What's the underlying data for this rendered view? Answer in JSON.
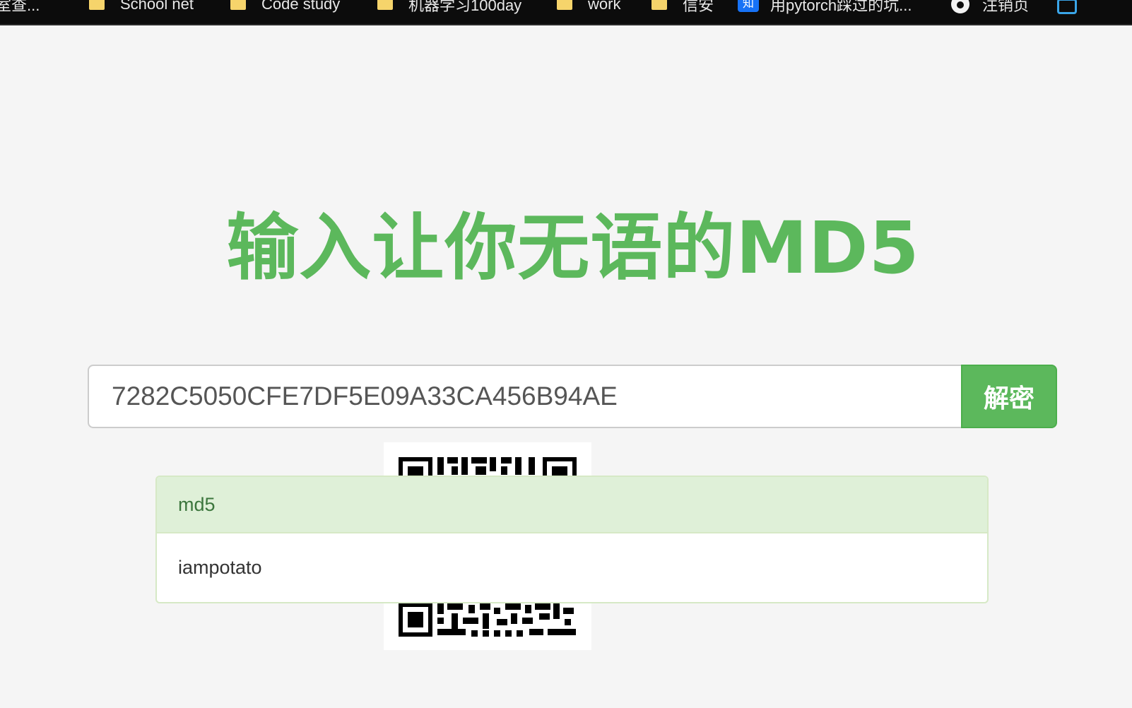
{
  "bookmarks": [
    {
      "label": "室查...",
      "icon": "folder-icon"
    },
    {
      "label": "School net",
      "icon": "folder-icon"
    },
    {
      "label": "Code study",
      "icon": "folder-icon"
    },
    {
      "label": "机器学习100day",
      "icon": "folder-icon"
    },
    {
      "label": "work",
      "icon": "folder-icon"
    },
    {
      "label": "信安",
      "icon": "folder-icon"
    },
    {
      "label": "用pytorch踩过的坑...",
      "icon": "zhihu-icon",
      "icon_text": "知"
    },
    {
      "label": "注销页",
      "icon": "github-icon"
    }
  ],
  "title": "输入让你无语的MD5",
  "search": {
    "value": "7282C5050CFE7DF5E09A33CA456B94AE"
  },
  "decrypt_button_label": "解密",
  "result": {
    "heading": "md5",
    "value": "iampotato"
  },
  "colors": {
    "accent": "#5cb85c",
    "panel_heading_bg": "#dff0d8",
    "panel_heading_text": "#3c763d",
    "bookmark_bar_bg": "#0c0c0c"
  }
}
